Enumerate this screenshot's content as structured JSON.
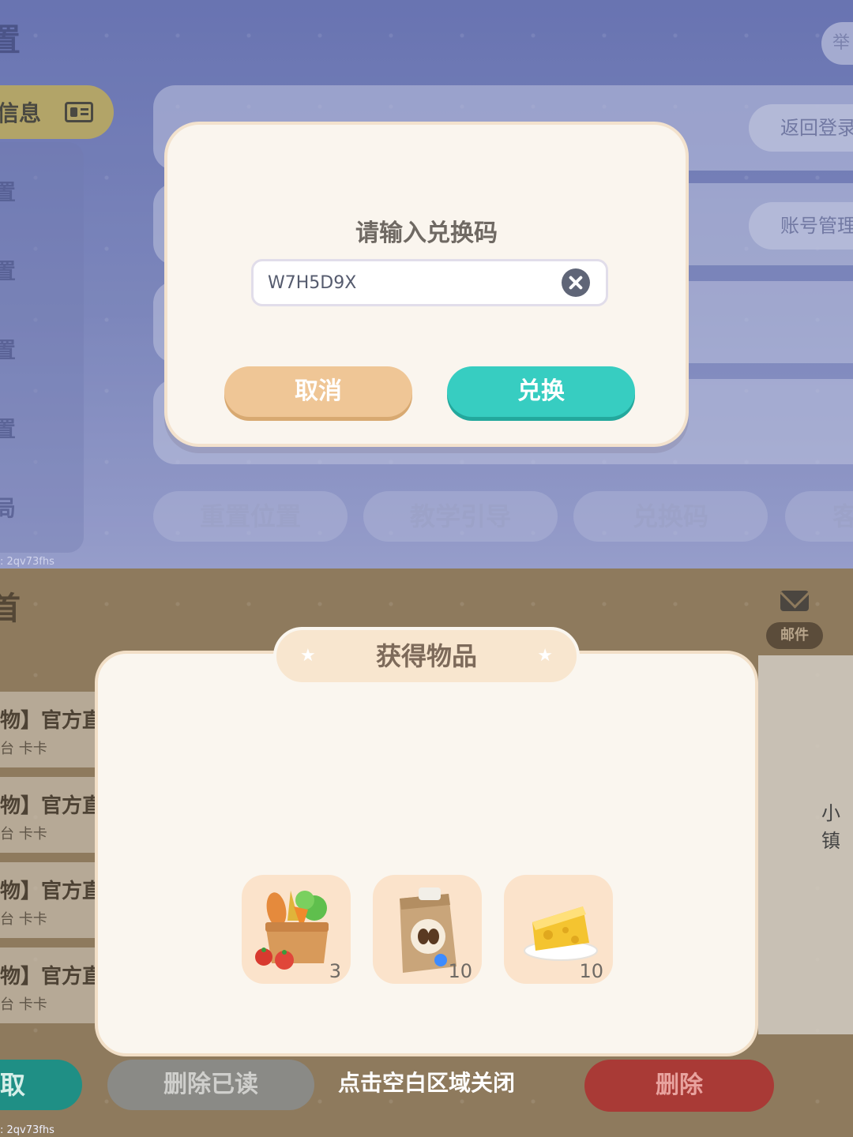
{
  "top": {
    "page_title": "置",
    "top_right_pill": "举",
    "sidebar": {
      "active_label": "信息",
      "items": [
        "置",
        "置",
        "置",
        "置",
        "局"
      ]
    },
    "pills": {
      "back_login": "返回登录",
      "account_manage": "账号管理"
    },
    "bottom_tabs": [
      "重置位置",
      "教学引导",
      "兑换码",
      "客"
    ],
    "watermark": ": 2qv73fhs"
  },
  "redeem_dialog": {
    "title": "请输入兑换码",
    "input_value": "W7H5D9X",
    "cancel_label": "取消",
    "redeem_label": "兑换"
  },
  "bottom": {
    "page_title": "首",
    "mail_tab_label": "邮件",
    "mail_rows": [
      {
        "title": "物】官方直",
        "subtitle": "台 卡卡"
      },
      {
        "title": "物】官方直",
        "subtitle": "台 卡卡"
      },
      {
        "title": "物】官方直",
        "subtitle": "台 卡卡"
      },
      {
        "title": "物】官方直",
        "subtitle": "台 卡卡"
      }
    ],
    "right_text": "小镇",
    "claim_label": "取",
    "delete_read_label": "删除已读",
    "close_hint": "点击空白区域关闭",
    "delete_label": "删除",
    "watermark": ": 2qv73fhs"
  },
  "reward_dialog": {
    "title": "获得物品",
    "items": [
      {
        "icon": "vegetable-basket-icon",
        "qty": "3"
      },
      {
        "icon": "coffee-bean-bag-icon",
        "qty": "10"
      },
      {
        "icon": "cheese-icon",
        "qty": "10"
      }
    ]
  }
}
